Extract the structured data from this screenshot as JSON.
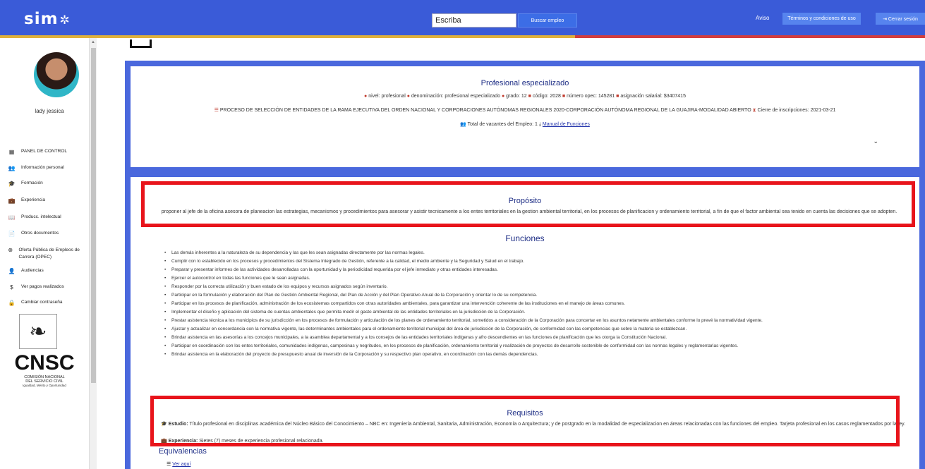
{
  "header": {
    "logo_text": "sim",
    "logo_gear": "✲",
    "search_placeholder": "Escriba",
    "search_button": "Buscar empleo",
    "aviso": "Aviso",
    "terms_button": "Términos y condiciones de uso",
    "logout_button": "⇥ Cerrar sesión",
    "colors": {
      "bar": "#3a5bd8",
      "stripe_left": "#e0b13b",
      "stripe_right": "#d33d3d"
    }
  },
  "sidebar": {
    "username": "lady jessica",
    "items": [
      {
        "icon": "dashboard-icon",
        "glyph": "▦",
        "label": "PANEL DE CONTROL"
      },
      {
        "icon": "people-icon",
        "glyph": "👥",
        "label": "Información personal"
      },
      {
        "icon": "graduation-icon",
        "glyph": "🎓",
        "label": "Formación"
      },
      {
        "icon": "briefcase-icon",
        "glyph": "💼",
        "label": "Experiencia"
      },
      {
        "icon": "book-icon",
        "glyph": "📖",
        "label": "Producc. intelectual"
      },
      {
        "icon": "document-icon",
        "glyph": "📄",
        "label": "Otros documentos"
      },
      {
        "icon": "target-icon",
        "glyph": "⊗",
        "label": "Oferta Pública de Empleos de Carrera (OPEC)"
      },
      {
        "icon": "audience-icon",
        "glyph": "👤",
        "label": "Audiencias"
      },
      {
        "icon": "dollar-icon",
        "glyph": "$",
        "label": "Ver pagos realizados"
      },
      {
        "icon": "lock-icon",
        "glyph": "🔒",
        "label": "Cambiar contraseña"
      }
    ],
    "logo": {
      "word": "CNSC",
      "line1": "COMISIÓN NACIONAL",
      "line2": "DEL SERVICIO CIVIL",
      "line3": "Igualdad, Mérito y Oportunidad"
    }
  },
  "job": {
    "title": "Profesional especializado",
    "nivel": "nivel: profesional",
    "denominacion": "denominación: profesional especializado",
    "grado": "grado: 12",
    "codigo": "código: 2028",
    "opec": "número opec: 145281",
    "asignacion": "asignación salarial: $3407415",
    "proceso": "PROCESO DE SELECCIÓN DE ENTIDADES DE LA RAMA EJECUTIVA DEL ORDEN NACIONAL Y CORPORACIONES AUTÓNOMAS REGIONALES 2020-CORPORACIÓN AUTÓNOMA REGIONAL DE LA GUAJIRA-MODALIDAD ABIERTO",
    "cierre": "Cierre de inscripciones: 2021-03-21",
    "vacantes": "Total de vacantes del Empleo: 1",
    "manual": "Manual de Funciones"
  },
  "proposito": {
    "title": "Propósito",
    "text": "proponer al jefe de la oficina asesora de planeacion las estrategias, mecanismos y procedimientos para asesorar y asistir tecnicamente a los entes territoriales en la gestion ambiental territorial, en los procesos de planificacion y ordenamiento territorial, a fin de que el factor ambiental sea tenido en cuenta las decisiones que se adopten."
  },
  "funciones": {
    "title": "Funciones",
    "items": [
      "Las demás inherentes a la naturaleza de su dependencia y las que les sean asignadas directamente por las normas legales.",
      "Cumplir con lo establecido en los procesos y procedimientos del Sistema Integrado de Gestión, referente a la calidad, el medio ambiente y la Seguridad y Salud en el trabajo.",
      "Preparar y presentar informes de las actividades desarrolladas con la oportunidad y la periodicidad requerida por el jefe inmediato y otras entidades interesadas.",
      "Ejercer el autocontrol en todas las funciones que le sean asignadas.",
      "Responder por la correcta utilización y buen estado de los equipos y recursos asignados según inventario.",
      "Participar en la formulación y elaboración del Plan de Gestión Ambiental Regional, del Plan de Acción y del Plan Operativo Anual de la Corporación y orientar lo de su competencia.",
      "Participar en los procesos de planificación, administración de los ecosistemas compartidos con otras autoridades ambientales, para garantizar una intervención coherente de las instituciones en el manejo de áreas comunes.",
      "Implementar el diseño y aplicación del sistema de cuentas ambientales que permita medir el gasto ambiental de las entidades territoriales en la jurisdicción de la Corporación.",
      "Prestar asistencia técnica a los municipios de su jurisdicción en los procesos de formulación y articulación de los planes de ordenamiento territorial, sometidos a consideración de la Corporación para concertar en los asuntos netamente ambientales conforme lo prevé la normatividad vigente.",
      "Ajustar y actualizar en concordancia con la normativa vigente, las determinantes ambientales para el ordenamiento territorial municipal del área de jurisdicción de la Corporación, de conformidad con las competencias que sobre la materia se establezcan.",
      "Brindar asistencia en las asesorías a los concejos municipales, a la asamblea departamental y a los consejos de las entidades territoriales indígenas y afro descendientes en las funciones de planificación que les otorga la Constitución Nacional.",
      "Participar en coordinación con los entes territoriales, comunidades indígenas, campesinas y negritudes, en los procesos de planificación, ordenamiento territorial y realización de proyectos de desarrollo sostenible de conformidad con las normas legales y reglamentarias vigentes.",
      "Brindar asistencia en la elaboración del proyecto de presupuesto anual de inversión de la Corporación y su respectivo plan operativo, en coordinación con las demás dependencias."
    ]
  },
  "requisitos": {
    "title": "Requisitos",
    "estudio_label": "Estudio:",
    "estudio_text": "Título profesional en disciplinas académica del Núcleo Básico del Conocimiento – NBC en: Ingeniería Ambiental, Sanitaria, Administración, Economía o Arquitectura; y de postgrado en la modalidad de especializacion en áreas relacionadas con las funciones del empleo. Tarjeta profesional en los casos reglamentados por la ley.",
    "experiencia_label": "Experiencia:",
    "experiencia_text": "Sietes (7) meses de experiencia profesional relacionada."
  },
  "equivalencias": {
    "title": "Equivalencias",
    "link": "Ver aquí"
  }
}
